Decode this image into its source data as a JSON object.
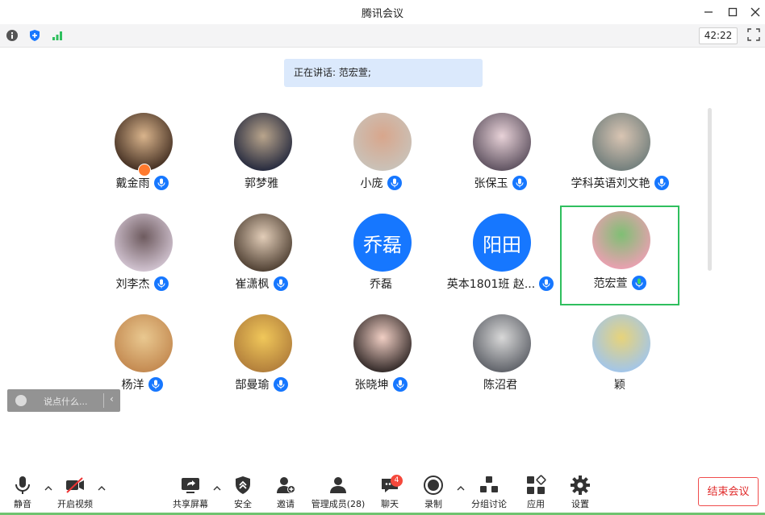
{
  "window": {
    "title": "腾讯会议"
  },
  "toolbar": {
    "timer": "42:22"
  },
  "speaking": {
    "text": "正在讲话: 范宏萱;"
  },
  "participants": [
    {
      "name": "戴金雨",
      "initial": "",
      "photo": [
        "#3e2a1e",
        "#d9b48c"
      ]
    },
    {
      "name": "郭梦雅",
      "initial": "",
      "photo": [
        "#20253b",
        "#b9a58c"
      ]
    },
    {
      "name": "小庞",
      "initial": "",
      "photo": [
        "#c9c3ba",
        "#d8a68c"
      ]
    },
    {
      "name": "张保玉",
      "initial": "",
      "photo": [
        "#5a4e5c",
        "#e8d2d8"
      ]
    },
    {
      "name": "学科英语刘文艳",
      "initial": "",
      "photo": [
        "#6e7c7a",
        "#d9c5b3"
      ]
    },
    {
      "name": "刘李杰",
      "initial": "",
      "photo": [
        "#d6c8d6",
        "#6e5b5f"
      ]
    },
    {
      "name": "崔潇枫",
      "initial": "",
      "photo": [
        "#4a3b2e",
        "#e2cdb8"
      ]
    },
    {
      "name": "乔磊",
      "initial": "乔磊",
      "photo": [
        "#1677ff",
        "#1677ff"
      ]
    },
    {
      "name": "英本1801班 赵...",
      "initial": "阳田",
      "photo": [
        "#1677ff",
        "#1677ff"
      ]
    },
    {
      "name": "范宏萱",
      "initial": "",
      "photo": [
        "#ef9fb4",
        "#7fbf74"
      ]
    },
    {
      "name": "杨洋",
      "initial": "",
      "photo": [
        "#c2874e",
        "#e9c890"
      ]
    },
    {
      "name": "郜曼瑜",
      "initial": "",
      "photo": [
        "#b07c3a",
        "#f0c75a"
      ]
    },
    {
      "name": "张晓坤",
      "initial": "",
      "photo": [
        "#2b2322",
        "#f1cfc4"
      ]
    },
    {
      "name": "陈沼君",
      "initial": "",
      "photo": [
        "#5b5e65",
        "#d8d8d8"
      ]
    },
    {
      "name": "颖",
      "initial": "",
      "photo": [
        "#9fc5ef",
        "#e7d37a"
      ]
    }
  ],
  "chat": {
    "placeholder": "说点什么..."
  },
  "bottom": {
    "mute": "静音",
    "video": "开启视频",
    "share": "共享屏幕",
    "security": "安全",
    "invite": "邀请",
    "members": "管理成员(28)",
    "chat": "聊天",
    "chat_badge": "4",
    "record": "录制",
    "breakout": "分组讨论",
    "apps": "应用",
    "settings": "设置",
    "end": "结束会议"
  },
  "colors": {
    "accent": "#1677ff",
    "active_border": "#2fbf5e",
    "end": "#e02a2a"
  }
}
